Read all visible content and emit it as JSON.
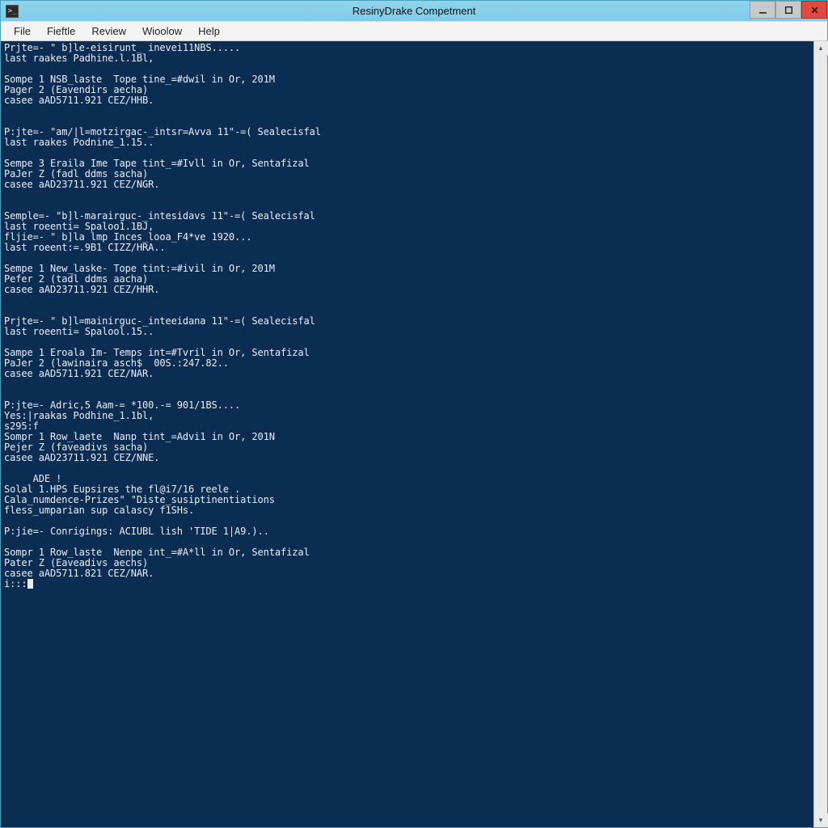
{
  "window": {
    "title": "ResinyDrake Competment",
    "app_icon_glyph": ">_"
  },
  "menu": {
    "items": [
      "File",
      "Fieftle",
      "Review",
      "Wioolow",
      "Help"
    ]
  },
  "win_controls": {
    "minimize": "minimize",
    "maximize": "maximize",
    "close": "close"
  },
  "console": {
    "lines": [
      "Prjte=- \" b]le-eisirunt_ inevei11NBS.....",
      "last raakes Padhine.l.1Bl,",
      "",
      "Sompe 1 NSB_laste  Tope tine_=#dwil in Or, 201M",
      "Pager 2 (Eavendirs aecha)",
      "casee aAD5711.921 CEZ/HHB.",
      "",
      "",
      "P:jte=- \"am/|l=motzirgac-_intsr=Avva 11\"-=( Sealecisfal",
      "last raakes Podnine_1.15..",
      "",
      "Sempe 3 Eraila Ime Tape tint_=#Ivll in Or, Sentafizal",
      "PaJer Z (fadl ddms sacha)",
      "casee aAD23711.921 CEZ/NGR.",
      "",
      "",
      "Semple=- \"b]l-marairguc-_intesidavs 11\"-=( Sealecisfal",
      "last roeenti= Spaloo1.1BJ,",
      "fljie=- \" b]la lmp Inces_looa_F4*ve 1920...",
      "last roeent:=.9B1 CIZZ/HRA..",
      "",
      "Sempe 1 New_laske- Tope tint:=#ivil in Or, 201M",
      "Pefer 2 (tadl ddms aacha)",
      "casee aAD23711.921 CEZ/HHR.",
      "",
      "",
      "Prjte=- \" b]l=mainirguc-_inteeidana 11\"-=( Sealecisfal",
      "last roeenti= Spalool.15..",
      "",
      "Sampe 1 Eroala Im- Temps int=#Tvril in Or, Sentafizal",
      "PaJer 2 (lawinaira asch$  00S.:247.82..",
      "casee aAD5711.921 CEZ/NAR.",
      "",
      "",
      "P:jte=- Adric,5 Aam-= *100.-= 901/1BS....",
      "Yes:|raakas Podhine_1.1bl,",
      "s295:f",
      "Sompr 1 Row_laete  Nanp tint_=Advi1 in Or, 201N",
      "Pejer Z (faveadivs sacha)",
      "casee aAD23711.921 CEZ/NNE.",
      "",
      "     ADE !",
      "Solal 1.HPS Eupsires the fl@i7/16 reele .",
      "Cala_numdence-Prizes\" \"Diste_susiptinentiations",
      "fless_umparian sup calascy f1SHs.",
      "",
      "P:jie=- Conrigings: ACIUBL lish 'TIDE 1|A9.)..",
      "",
      "Sompr 1 Row_laste  Nenpe int_=#A*ll in Or, Sentafizal",
      "Pater Z (Eaveadivs aechs)",
      "casee aAD5711.821 CEZ/NAR."
    ],
    "prompt": "i:::"
  }
}
